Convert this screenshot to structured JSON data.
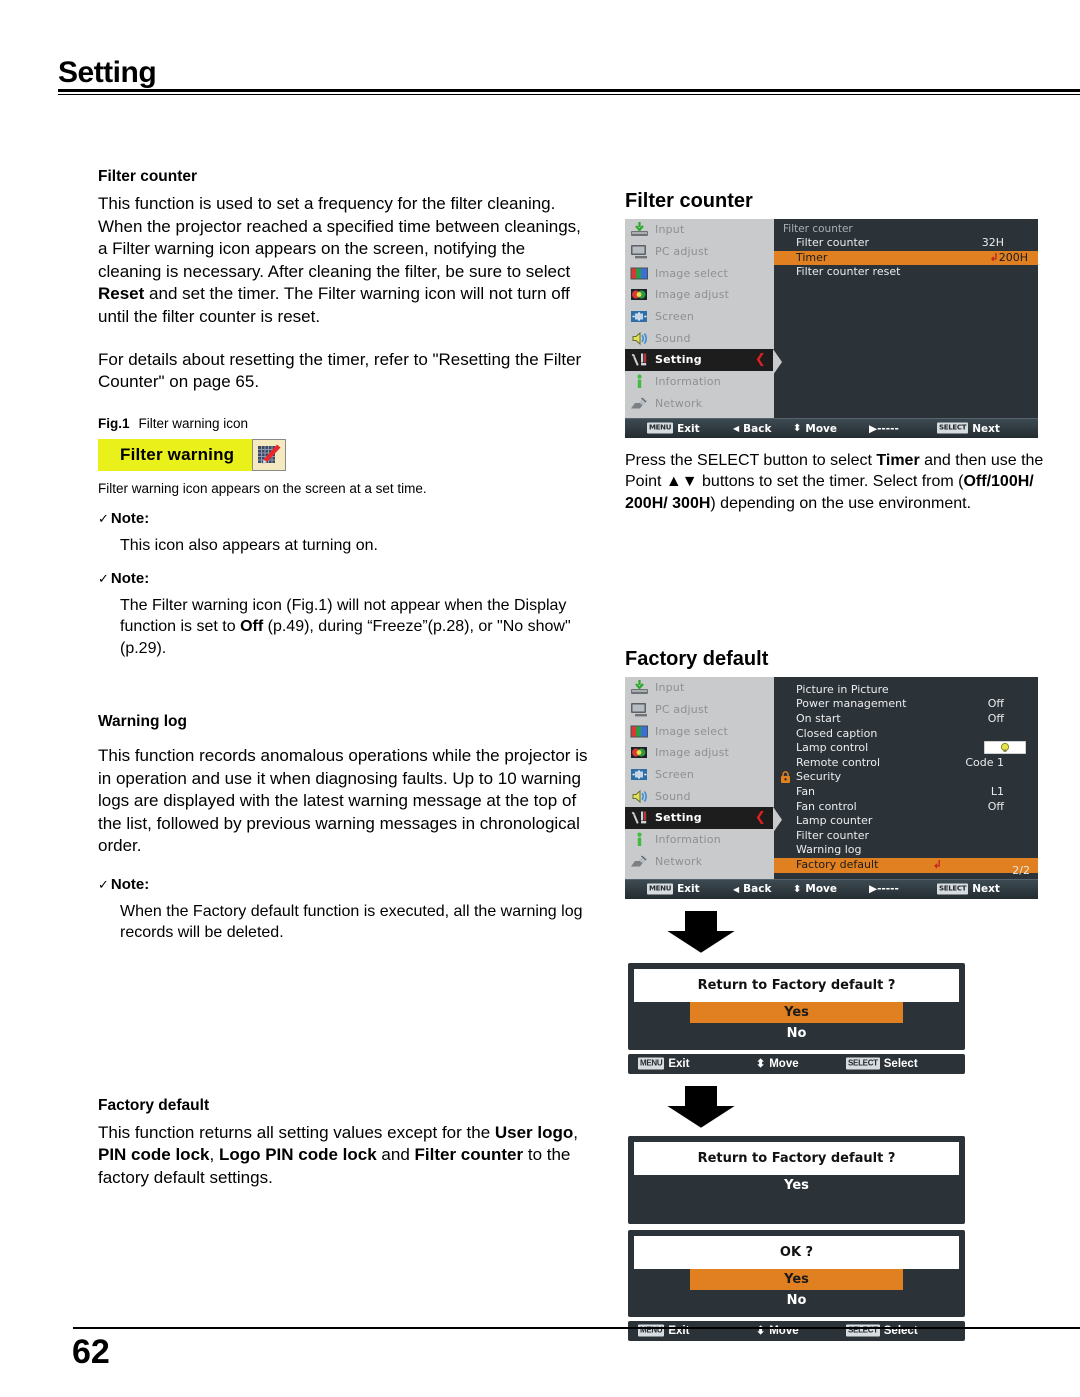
{
  "header": {
    "chapter": "Setting"
  },
  "footer": {
    "page_number": "62"
  },
  "left": {
    "filter_counter": {
      "heading": "Filter counter",
      "para1": "This function is used to set a frequency for the filter cleaning.",
      "para2_a": "When the projector reached a specified time between cleanings, a Filter warning icon appears on the screen, notifying the cleaning is necessary. After cleaning the filter, be sure to select ",
      "para2_bold": "Reset",
      "para2_b": " and set the timer. The Filter warning icon will not turn off until the filter counter is reset.",
      "para3": "For details about resetting the timer, refer to \"Resetting the Filter Counter\" on page 65."
    },
    "figure": {
      "label": "Fig.1",
      "caption": "Filter warning icon",
      "banner_text": "Filter warning",
      "banner_bg": "#eaf01a",
      "icon_name": "filter-pen-icon",
      "below_text": "Filter warning icon appears on the screen at a set time."
    },
    "note1": {
      "check": "✓",
      "title": "Note:",
      "body": "This icon also appears at turning on."
    },
    "note2": {
      "check": "✓",
      "title": "Note:",
      "body_a": "The Filter warning icon (Fig.1) will not appear when the Display function is set to ",
      "body_bold": "Off",
      "body_b": " (p.49), during “Freeze”(p.28), or \"No show\" (p.29)."
    },
    "warning_log": {
      "heading": "Warning log",
      "para": "This function records anomalous operations while the projector is in operation and use it when diagnosing faults. Up to 10 warning logs are displayed with the latest warning message at the top of the list, followed by previous warning messages in chronological order."
    },
    "note3": {
      "check": "✓",
      "title": "Note:",
      "body": "When the Factory default function is executed, all the warning log records will be deleted."
    },
    "factory_default": {
      "heading": "Factory default",
      "para_a": "This function returns all setting values except for the ",
      "para_b1": "User logo",
      "para_c": ", ",
      "para_b2": "PIN code lock",
      "para_d": ", ",
      "para_b3": "Logo PIN code lock",
      "para_e": " and ",
      "para_b4": "Filter counter",
      "para_f": " to the factory default settings."
    }
  },
  "right": {
    "osd1": {
      "title": "Filter counter",
      "sidebar": [
        {
          "label": "Input",
          "icon": "input-icon",
          "active": false
        },
        {
          "label": "PC adjust",
          "icon": "monitor-icon",
          "active": false
        },
        {
          "label": "Image select",
          "icon": "image-select-icon",
          "active": false
        },
        {
          "label": "Image adjust",
          "icon": "image-adjust-icon",
          "active": false
        },
        {
          "label": "Screen",
          "icon": "screen-icon",
          "active": false
        },
        {
          "label": "Sound",
          "icon": "speaker-icon",
          "active": false
        },
        {
          "label": "Setting",
          "icon": "tools-icon",
          "active": true
        },
        {
          "label": "Information",
          "icon": "info-icon",
          "active": false
        },
        {
          "label": "Network",
          "icon": "network-icon",
          "active": false
        }
      ],
      "panel_header": "Filter counter",
      "items": [
        {
          "label": "Filter counter",
          "value": "32H",
          "selected": false,
          "enter": false
        },
        {
          "label": "Timer",
          "value": "200H",
          "selected": true,
          "enter": true
        },
        {
          "label": "Filter counter reset",
          "value": "",
          "selected": false,
          "enter": false
        }
      ],
      "bar": {
        "exit_badge": "MENU",
        "exit": "Exit",
        "back_arrow": "◀",
        "back": "Back",
        "move_arrow": "⬍",
        "move": "Move",
        "point": "▶-----",
        "next_badge": "SELECT",
        "next": "Next"
      },
      "caption_a": "Press the SELECT button to select  ",
      "caption_bold1": "Timer",
      "caption_b": " and then use the Point ▲▼ buttons to set the timer. Select from (",
      "caption_bold2": "Off/100H/ 200H/ 300H",
      "caption_c": ") depending on the use environment."
    },
    "osd2": {
      "title": "Factory default",
      "sidebar": [
        {
          "label": "Input",
          "icon": "input-icon",
          "active": false
        },
        {
          "label": "PC adjust",
          "icon": "monitor-icon",
          "active": false
        },
        {
          "label": "Image select",
          "icon": "image-select-icon",
          "active": false
        },
        {
          "label": "Image adjust",
          "icon": "image-adjust-icon",
          "active": false
        },
        {
          "label": "Screen",
          "icon": "screen-icon",
          "active": false
        },
        {
          "label": "Sound",
          "icon": "speaker-icon",
          "active": false
        },
        {
          "label": "Setting",
          "icon": "tools-icon",
          "active": true
        },
        {
          "label": "Information",
          "icon": "info-icon",
          "active": false
        },
        {
          "label": "Network",
          "icon": "network-icon",
          "active": false
        }
      ],
      "items": [
        {
          "label": "Picture in Picture",
          "value": "",
          "selected": false,
          "lock": false,
          "enter": false,
          "lamp": false
        },
        {
          "label": "Power management",
          "value": "Off",
          "selected": false,
          "lock": false,
          "enter": false,
          "lamp": false
        },
        {
          "label": "On start",
          "value": "Off",
          "selected": false,
          "lock": false,
          "enter": false,
          "lamp": false
        },
        {
          "label": "Closed caption",
          "value": "",
          "selected": false,
          "lock": false,
          "enter": false,
          "lamp": false
        },
        {
          "label": "Lamp control",
          "value": "",
          "selected": false,
          "lock": false,
          "enter": false,
          "lamp": true
        },
        {
          "label": "Remote control",
          "value": "Code 1",
          "selected": false,
          "lock": false,
          "enter": false,
          "lamp": false
        },
        {
          "label": "Security",
          "value": "",
          "selected": false,
          "lock": true,
          "enter": false,
          "lamp": false
        },
        {
          "label": "Fan",
          "value": "L1",
          "selected": false,
          "lock": false,
          "enter": false,
          "lamp": false
        },
        {
          "label": "Fan control",
          "value": "Off",
          "selected": false,
          "lock": false,
          "enter": false,
          "lamp": false
        },
        {
          "label": "Lamp counter",
          "value": "",
          "selected": false,
          "lock": false,
          "enter": false,
          "lamp": false
        },
        {
          "label": "Filter counter",
          "value": "",
          "selected": false,
          "lock": false,
          "enter": false,
          "lamp": false
        },
        {
          "label": "Warning log",
          "value": "",
          "selected": false,
          "lock": false,
          "enter": false,
          "lamp": false
        },
        {
          "label": "Factory default",
          "value": "",
          "selected": true,
          "lock": false,
          "enter": true,
          "lamp": false
        }
      ],
      "page_indicator": "2/2",
      "bar": {
        "exit_badge": "MENU",
        "exit": "Exit",
        "back_arrow": "◀",
        "back": "Back",
        "move_arrow": "⬍",
        "move": "Move",
        "point": "▶-----",
        "next_badge": "SELECT",
        "next": "Next"
      }
    },
    "dialog1": {
      "question": "Return to Factory default ?",
      "yes": "Yes",
      "no": "No",
      "bar": {
        "exit_badge": "MENU",
        "exit": "Exit",
        "move_arrow": "⬍",
        "move": "Move",
        "select_badge": "SELECT",
        "select": "Select"
      }
    },
    "dialog2": {
      "question": "Return to Factory default ?",
      "yes": "Yes"
    },
    "dialog3": {
      "question": "OK ?",
      "yes": "Yes",
      "no": "No",
      "bar": {
        "exit_badge": "MENU",
        "exit": "Exit",
        "move_arrow": "⬍",
        "move": "Move",
        "select_badge": "SELECT",
        "select": "Select"
      }
    }
  },
  "colors": {
    "highlight_orange": "#e08020",
    "warning_yellow": "#eaf01a",
    "osd_dark": "#2b3339",
    "osd_sidebar": "#c9cacb",
    "caret_red": "#e02020"
  }
}
